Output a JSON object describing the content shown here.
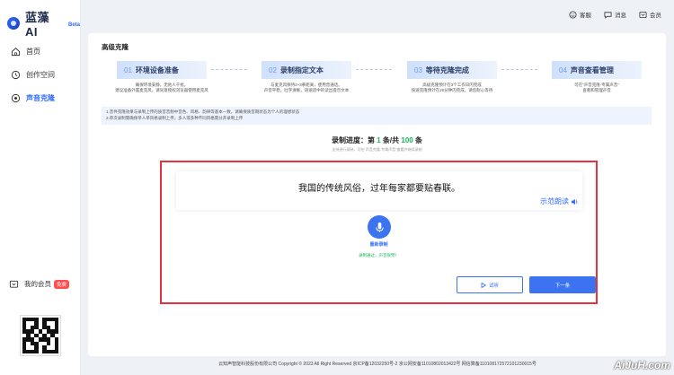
{
  "brand": {
    "name": "蓝藻 AI",
    "beta": "Beta"
  },
  "nav": [
    {
      "label": "首页",
      "icon": "home-icon",
      "active": false
    },
    {
      "label": "创作空间",
      "icon": "clock-icon",
      "active": false
    },
    {
      "label": "声音克隆",
      "icon": "voice-icon",
      "active": true
    }
  ],
  "member": {
    "label": "我的会员",
    "tag": "免费"
  },
  "topbar": {
    "service": "客服",
    "messages": "消息",
    "member": "会员"
  },
  "page": {
    "title": "高级克隆"
  },
  "steps": [
    {
      "num": "01",
      "title": "环境设备准备",
      "desc1": "确保环境安静，无他人干扰。",
      "desc2": "建议准备外置麦克风，请同意授权浏览器使用麦克风"
    },
    {
      "num": "02",
      "title": "录制指定文本",
      "desc1": "与麦克风保持2~3拳距离，使用普通话。",
      "desc2": "声音平稳，吐字清晰，语速适中的读出提示文本"
    },
    {
      "num": "03",
      "title": "等待克隆完成",
      "desc1": "高级克隆预计在3个工作日内完成",
      "desc2": "快速克隆预计在20分钟内完成，请您耐心等待"
    },
    {
      "num": "04",
      "title": "声音查看管理",
      "desc1": "可在\"声音克隆-专属声音\"",
      "desc2": "查看和管理声音"
    }
  ],
  "notice": {
    "line1": "1.音件克隆效果与录制上传的质音音频中音色、风格、韵律等基本一致，请确保质音期状态为个人的理想状态",
    "line2": "2.单次录制需确保单人单风格录制上传，多人或多种不同风格需分开录制上传"
  },
  "progress": {
    "prefix": "录制进度：第",
    "current": "1",
    "middle": "条/共",
    "total": "100",
    "suffix": "条",
    "hint": "支持进行录制，可在\"声音克隆-专属声音\"查看并继续录制"
  },
  "record": {
    "sentence": "我国的传统风俗，过年每家都要贴春联。",
    "demo": "示范朗读",
    "rerecord": "重新录制",
    "passed": "录制通过，声音很赞！",
    "try": "试听",
    "next": "下一条"
  },
  "footer": "云知声智能科技股份有限公司 Copyright © 2023 All Right Reserved 京ICP备12032250号-2 京公网安备11010802013422号 网信算备110108172572101230015号",
  "watermark": "AiJuH.com",
  "colors": {
    "accent": "#2f6bff",
    "success": "#19b35c",
    "highlight": "#e5323f"
  }
}
